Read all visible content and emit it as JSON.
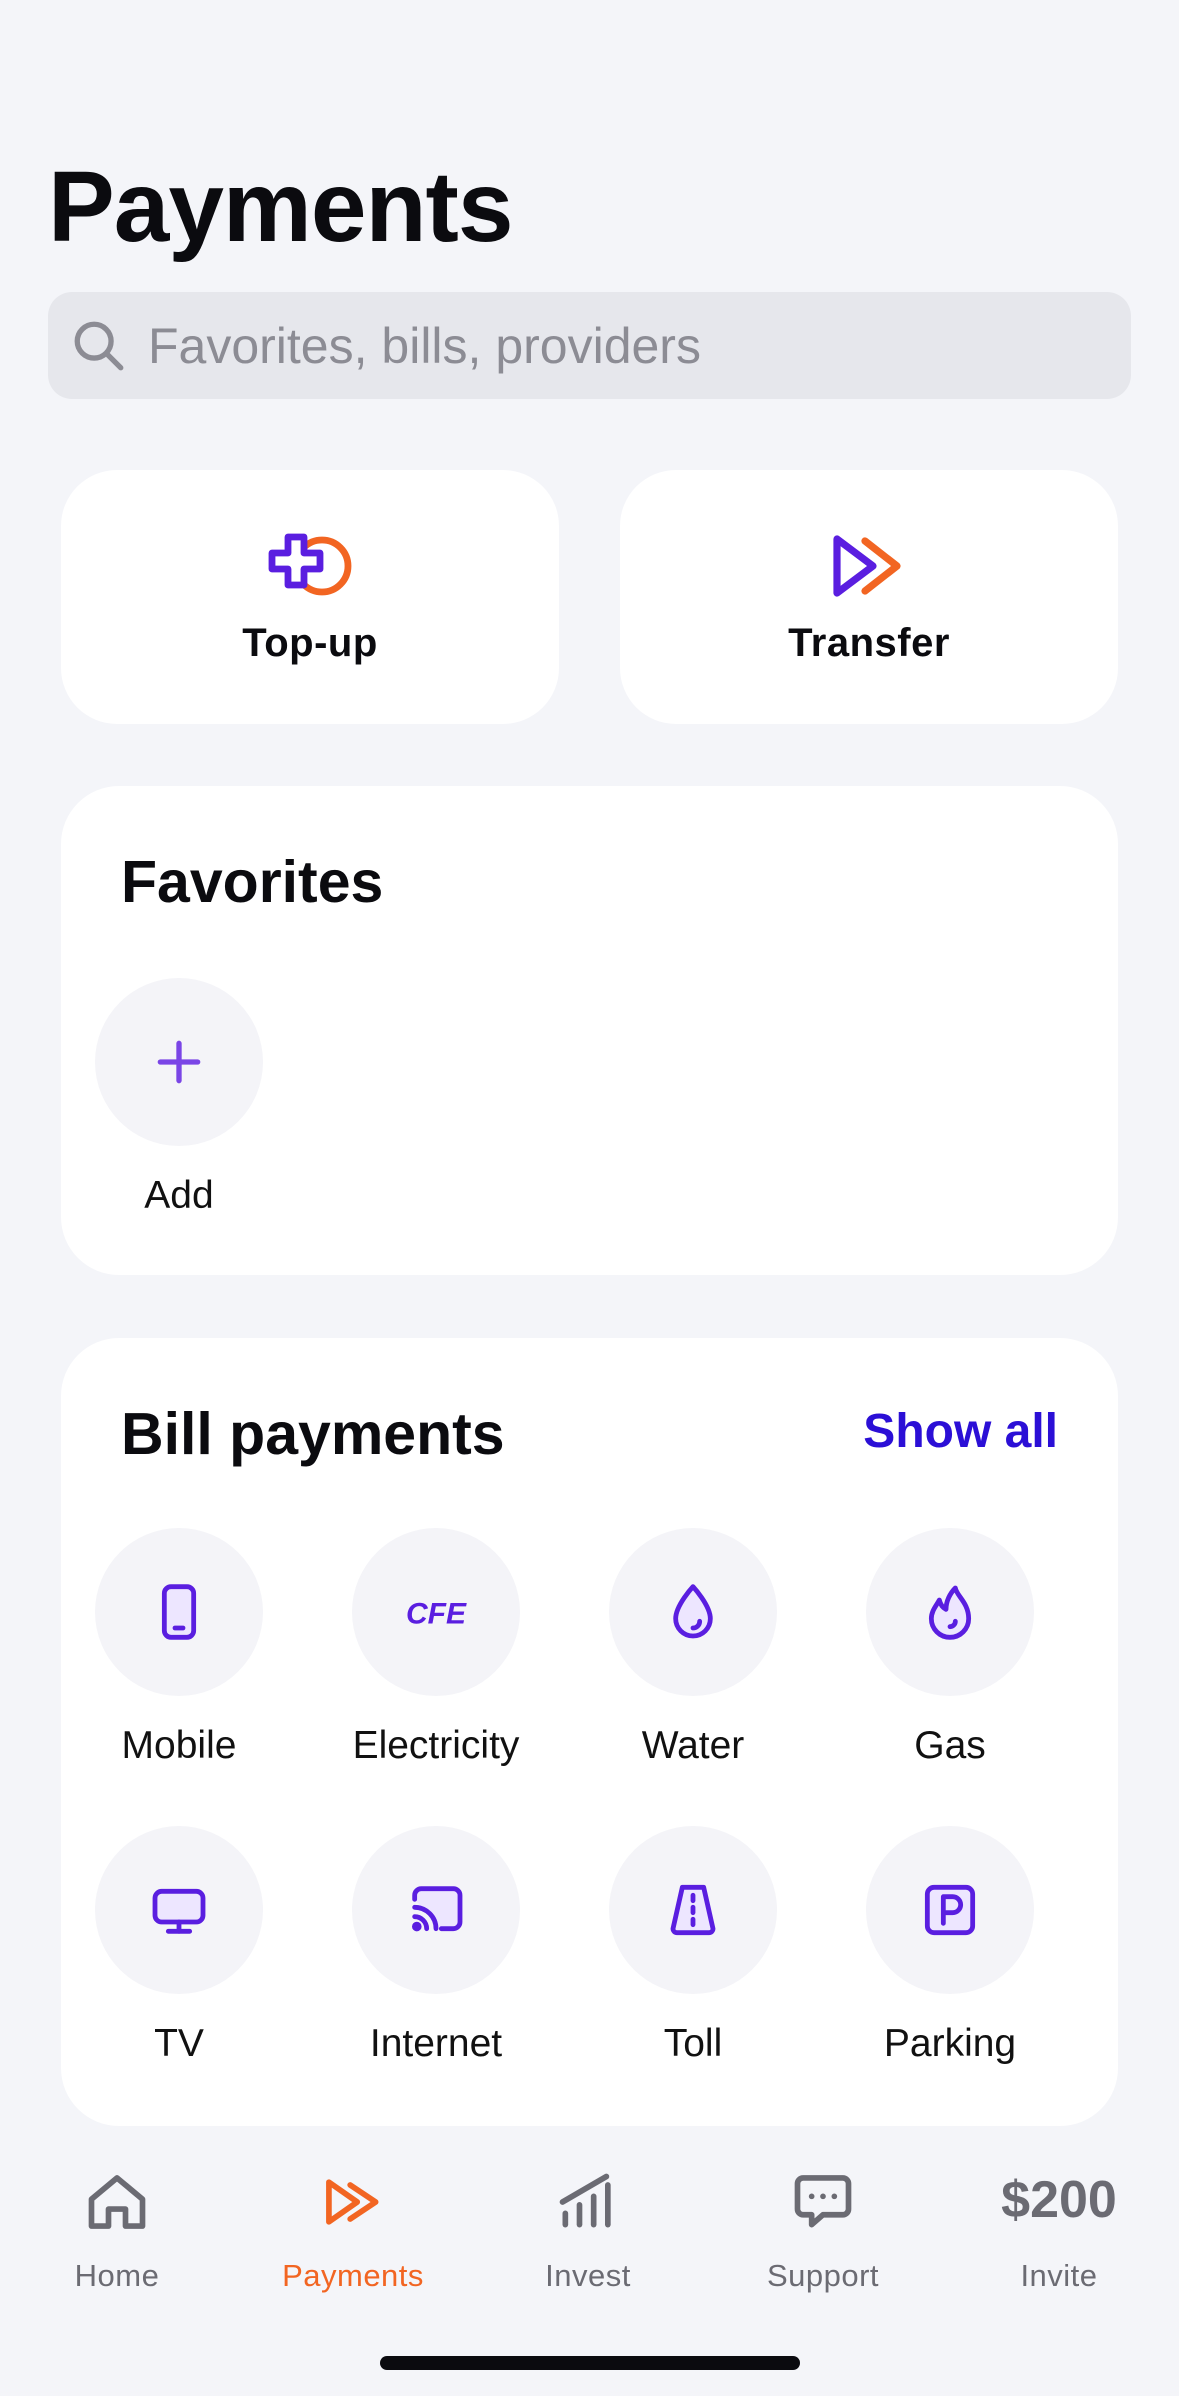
{
  "page": {
    "title": "Payments"
  },
  "search": {
    "placeholder": "Favorites, bills, providers",
    "icon": "search-icon"
  },
  "actions": [
    {
      "label": "Top-up",
      "icon": "topup-plus-icon"
    },
    {
      "label": "Transfer",
      "icon": "transfer-arrows-icon"
    }
  ],
  "favorites": {
    "title": "Favorites",
    "add_label": "Add",
    "add_icon": "plus-icon"
  },
  "bills": {
    "title": "Bill payments",
    "show_all": "Show all",
    "items": [
      {
        "label": "Mobile",
        "icon": "mobile-phone-icon"
      },
      {
        "label": "Electricity",
        "icon": "cfe-logo-icon",
        "logo_text": "CFE"
      },
      {
        "label": "Water",
        "icon": "water-drop-icon"
      },
      {
        "label": "Gas",
        "icon": "flame-icon"
      },
      {
        "label": "TV",
        "icon": "tv-icon"
      },
      {
        "label": "Internet",
        "icon": "cast-wifi-icon"
      },
      {
        "label": "Toll",
        "icon": "road-icon"
      },
      {
        "label": "Parking",
        "icon": "parking-icon"
      }
    ]
  },
  "tabbar": {
    "active": "Payments",
    "tabs": [
      {
        "label": "Home",
        "icon": "house-icon"
      },
      {
        "label": "Payments",
        "icon": "payments-arrows-icon"
      },
      {
        "label": "Invest",
        "icon": "bar-chart-icon"
      },
      {
        "label": "Support",
        "icon": "chat-bubble-icon"
      },
      {
        "label": "Invite",
        "value": "$200"
      }
    ]
  },
  "colors": {
    "background": "#f4f5f9",
    "accent_purple": "#5a1ee0",
    "accent_orange": "#f26522",
    "link_blue": "#2b0fd6",
    "tab_active": "#f26522",
    "tab_inactive": "#6b6b73"
  }
}
